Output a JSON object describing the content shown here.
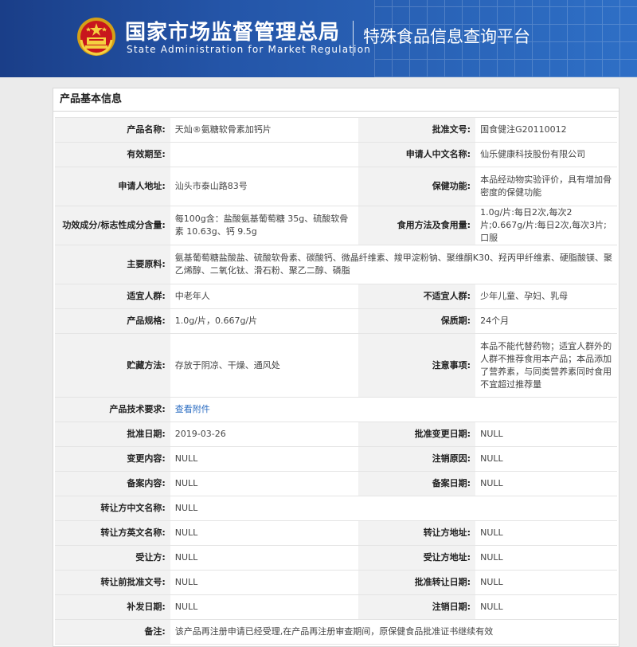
{
  "header": {
    "title_cn": "国家市场监督管理总局",
    "title_en": "State Administration  for  Market Regulation",
    "platform": "特殊食品信息查询平台"
  },
  "panel": {
    "title": "产品基本信息"
  },
  "fields": {
    "product_name": {
      "label": "产品名称:",
      "value": "天灿®氨糖软骨素加钙片"
    },
    "approval_no": {
      "label": "批准文号:",
      "value": "国食健注G20110012"
    },
    "valid_until": {
      "label": "有效期至:",
      "value": ""
    },
    "applicant_cn": {
      "label": "申请人中文名称:",
      "value": "仙乐健康科技股份有限公司"
    },
    "applicant_addr": {
      "label": "申请人地址:",
      "value": "汕头市泰山路83号"
    },
    "health_function": {
      "label": "保健功能:",
      "value": "本品经动物实验评价，具有增加骨密度的保健功能"
    },
    "ingredients_content": {
      "label": "功效成分/标志性成分含量:",
      "value": "每100g含：盐酸氨基葡萄糖 35g、硫酸软骨素 10.63g、钙 9.5g"
    },
    "dosage": {
      "label": "食用方法及食用量:",
      "value": "1.0g/片:每日2次,每次2片;0.667g/片:每日2次,每次3片;口服"
    },
    "main_materials": {
      "label": "主要原料:",
      "value": "氨基葡萄糖盐酸盐、硫酸软骨素、碳酸钙、微晶纤维素、羧甲淀粉钠、聚维酮K30、羟丙甲纤维素、硬脂酸镁、聚乙烯醇、二氧化钛、滑石粉、聚乙二醇、磷脂"
    },
    "suitable_people": {
      "label": "适宜人群:",
      "value": "中老年人"
    },
    "unsuitable_people": {
      "label": "不适宜人群:",
      "value": "少年儿童、孕妇、乳母"
    },
    "spec": {
      "label": "产品规格:",
      "value": "1.0g/片，0.667g/片"
    },
    "shelf_life": {
      "label": "保质期:",
      "value": "24个月"
    },
    "storage": {
      "label": "贮藏方法:",
      "value": "存放于阴凉、干燥、通风处"
    },
    "notes": {
      "label": "注意事项:",
      "value": "本品不能代替药物；适宜人群外的人群不推荐食用本产品；本品添加了营养素，与同类营养素同时食用不宜超过推荐量"
    },
    "tech_requirements": {
      "label": "产品技术要求:",
      "value": "查看附件"
    },
    "approval_date": {
      "label": "批准日期:",
      "value": "2019-03-26"
    },
    "approval_change_date": {
      "label": "批准变更日期:",
      "value": "NULL"
    },
    "change_content": {
      "label": "变更内容:",
      "value": "NULL"
    },
    "cancel_reason": {
      "label": "注销原因:",
      "value": "NULL"
    },
    "record_content": {
      "label": "备案内容:",
      "value": "NULL"
    },
    "record_date": {
      "label": "备案日期:",
      "value": "NULL"
    },
    "transferor_cn": {
      "label": "转让方中文名称:",
      "value": "NULL"
    },
    "transferor_en": {
      "label": "转让方英文名称:",
      "value": "NULL"
    },
    "transferor_addr": {
      "label": "转让方地址:",
      "value": "NULL"
    },
    "transferee": {
      "label": "受让方:",
      "value": "NULL"
    },
    "transferee_addr": {
      "label": "受让方地址:",
      "value": "NULL"
    },
    "pre_transfer_no": {
      "label": "转让前批准文号:",
      "value": "NULL"
    },
    "transfer_approval_date": {
      "label": "批准转让日期:",
      "value": "NULL"
    },
    "reissue_date": {
      "label": "补发日期:",
      "value": "NULL"
    },
    "cancel_date": {
      "label": "注销日期:",
      "value": "NULL"
    },
    "remarks": {
      "label": "备注:",
      "value": "该产品再注册申请已经受理,在产品再注册审查期间，原保健食品批准证书继续有效"
    }
  },
  "colors": {
    "header_blue": "#2455a8",
    "link": "#2a6cc2",
    "label_bg": "#f2f2f2"
  },
  "icons": {
    "emblem": "national-emblem-icon"
  }
}
